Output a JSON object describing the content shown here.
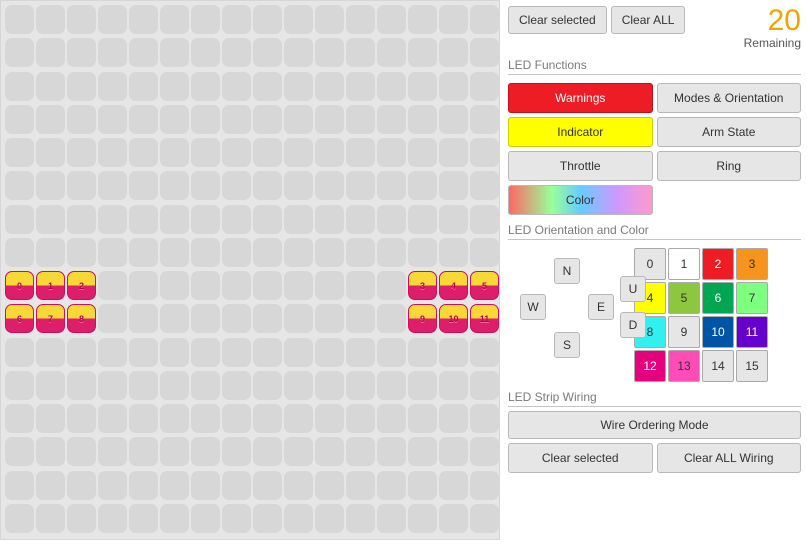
{
  "remaining": {
    "count": "20",
    "label": "Remaining"
  },
  "top_buttons": {
    "clear_selected": "Clear selected",
    "clear_all": "Clear ALL"
  },
  "sections": {
    "functions": "LED Functions",
    "orientation": "LED Orientation and Color",
    "wiring": "LED Strip Wiring"
  },
  "functions": {
    "warnings": "Warnings",
    "modes": "Modes & Orientation",
    "indicator": "Indicator",
    "arm": "Arm State",
    "throttle": "Throttle",
    "ring": "Ring",
    "color": "Color"
  },
  "directions": {
    "N": "N",
    "S": "S",
    "E": "E",
    "W": "W",
    "U": "U",
    "D": "D"
  },
  "wiring": {
    "mode": "Wire Ordering Mode",
    "clear_selected": "Clear selected",
    "clear_all": "Clear ALL Wiring"
  },
  "palette": [
    {
      "n": "0",
      "bg": "#e6e6e6",
      "dark": false
    },
    {
      "n": "1",
      "bg": "#ffffff",
      "dark": false
    },
    {
      "n": "2",
      "bg": "#ee1c25",
      "dark": true
    },
    {
      "n": "3",
      "bg": "#f7941e",
      "dark": false
    },
    {
      "n": "4",
      "bg": "#ffff00",
      "dark": false
    },
    {
      "n": "5",
      "bg": "#8dc73f",
      "dark": false
    },
    {
      "n": "6",
      "bg": "#00a651",
      "dark": true
    },
    {
      "n": "7",
      "bg": "#7fff7f",
      "dark": false
    },
    {
      "n": "8",
      "bg": "#33f0f0",
      "dark": false
    },
    {
      "n": "9",
      "bg": "#e6e6e6",
      "dark": false
    },
    {
      "n": "10",
      "bg": "#0054a6",
      "dark": true
    },
    {
      "n": "11",
      "bg": "#6600cc",
      "dark": true
    },
    {
      "n": "12",
      "bg": "#e5007e",
      "dark": true
    },
    {
      "n": "13",
      "bg": "#ff4db8",
      "dark": false
    },
    {
      "n": "14",
      "bg": "#e6e6e6",
      "dark": false
    },
    {
      "n": "15",
      "bg": "#e6e6e6",
      "dark": false
    }
  ],
  "grid": {
    "cols": 16,
    "rows": 16,
    "leds": [
      {
        "row": 8,
        "col": 0,
        "label": "0"
      },
      {
        "row": 8,
        "col": 1,
        "label": "1"
      },
      {
        "row": 8,
        "col": 2,
        "label": "2"
      },
      {
        "row": 8,
        "col": 13,
        "label": "3"
      },
      {
        "row": 8,
        "col": 14,
        "label": "4"
      },
      {
        "row": 8,
        "col": 15,
        "label": "5"
      },
      {
        "row": 9,
        "col": 0,
        "label": "6"
      },
      {
        "row": 9,
        "col": 1,
        "label": "7"
      },
      {
        "row": 9,
        "col": 2,
        "label": "8"
      },
      {
        "row": 9,
        "col": 13,
        "label": "9"
      },
      {
        "row": 9,
        "col": 14,
        "label": "10"
      },
      {
        "row": 9,
        "col": 15,
        "label": "11"
      }
    ]
  }
}
